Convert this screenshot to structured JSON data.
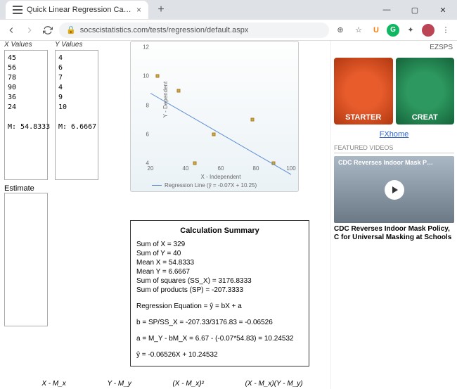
{
  "window": {
    "tab_title": "Quick Linear Regression Calculat",
    "url": "socscistatistics.com/tests/regression/default.aspx"
  },
  "headers": {
    "x": "X Values",
    "y": "Y Values",
    "estimate": "Estimate"
  },
  "xvals": "45\n56\n78\n90\n36\n24\n\nM: 54.8333",
  "yvals": "4\n6\n7\n4\n9\n10\n\nM: 6.6667",
  "chart_data": {
    "type": "scatter",
    "title": "",
    "xlabel": "X - Independent",
    "ylabel": "Y - Dependent",
    "xlim": [
      20,
      100
    ],
    "ylim": [
      4,
      12
    ],
    "xticks": [
      20,
      40,
      60,
      80,
      100
    ],
    "yticks": [
      4,
      6,
      8,
      10,
      12
    ],
    "points": [
      {
        "x": 45,
        "y": 4
      },
      {
        "x": 56,
        "y": 6
      },
      {
        "x": 78,
        "y": 7
      },
      {
        "x": 90,
        "y": 4
      },
      {
        "x": 36,
        "y": 9
      },
      {
        "x": 24,
        "y": 10
      }
    ],
    "regression": {
      "slope": -0.07,
      "intercept": 10.25
    },
    "legend": "Regression Line (ŷ = -0.07X + 10.25)"
  },
  "summary": {
    "title": "Calculation Summary",
    "lines": [
      "Sum of X = 329",
      "Sum of Y = 40",
      "Mean X = 54.8333",
      "Mean Y = 6.6667",
      "Sum of squares (SS_X) = 3176.8333",
      "Sum of products (SP) = -207.3333"
    ],
    "eq_label": "Regression Equation = ŷ = bX + a",
    "b_line": "b = SP/SS_X = -207.33/3176.83 = -0.06526",
    "a_line": "a = M_Y - bM_X = 6.67 - (-0.07*54.83) = 10.24532",
    "yhat": "ŷ = -0.06526X + 10.24532"
  },
  "bottom": [
    "X - M_x",
    "Y - M_y",
    "(X - M_x)²",
    "(X - M_x)(Y - M_y)"
  ],
  "sidebar": {
    "topbadge": "EZSPS",
    "starter": "STARTER",
    "creator": "CREAT",
    "link": "FXhome",
    "featured": "FEATURED VIDEOS",
    "vtitle": "CDC Reverses Indoor Mask P…",
    "vcaption": "CDC Reverses Indoor Mask Policy, C for Universal Masking at Schools"
  }
}
